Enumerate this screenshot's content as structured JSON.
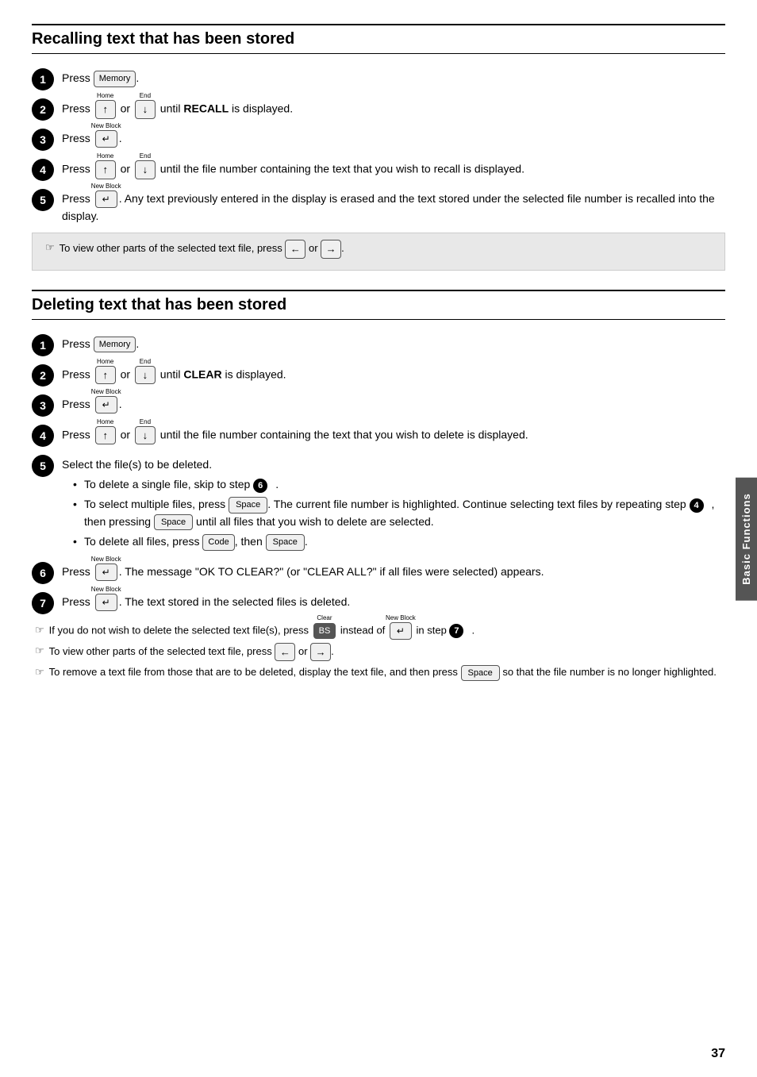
{
  "sections": [
    {
      "id": "recalling",
      "title": "Recalling text that has been stored",
      "steps": [
        {
          "num": 1,
          "text": "Press [Memory]."
        },
        {
          "num": 2,
          "text_before": "Press ",
          "arrow_up_label": "Home",
          "arrow_down_label": "End",
          "text_middle": " or ",
          "text_after": " until ",
          "bold": "RECALL",
          "text_end": " is displayed."
        },
        {
          "num": 3,
          "text": "Press [Enter]."
        },
        {
          "num": 4,
          "text_before": "Press ",
          "text_after": " until the file number containing the text that you wish to recall is displayed."
        },
        {
          "num": 5,
          "text_before": "Press [Enter].",
          "text_after": " Any text previously entered in the display is erased and the text stored under the selected file number is recalled into the display."
        }
      ],
      "tip": "To view other parts of the selected text file, press ← or →."
    }
  ],
  "sections2": [
    {
      "id": "deleting",
      "title": "Deleting text that has been stored",
      "steps": [
        {
          "num": 1,
          "text": "Press [Memory]."
        },
        {
          "num": 2,
          "text_before": "Press ",
          "text_after": " until ",
          "bold": "CLEAR",
          "text_end": " is displayed."
        },
        {
          "num": 3,
          "text": "Press [Enter]."
        },
        {
          "num": 4,
          "text_before": "Press ",
          "text_after": " until the file number containing the text that you wish to delete is displayed."
        },
        {
          "num": 5,
          "text": "Select the file(s) to be deleted.",
          "bullets": [
            "To delete a single file, skip to step 6.",
            "To select multiple files, press [Space]. The current file number is highlighted. Continue selecting text files by repeating step 4, then pressing [Space] until all files that you wish to delete are selected.",
            "To delete all files, press [Code], then [Space]."
          ]
        },
        {
          "num": 6,
          "text_before": "Press [Enter].",
          "text_after": " The message \"OK TO CLEAR?\" (or \"CLEAR ALL?\" if all files were selected) appears."
        },
        {
          "num": 7,
          "text_before": "Press [Enter].",
          "text_after": " The text stored in the selected files is deleted."
        }
      ],
      "tips": [
        "If you do not wish to delete the selected text file(s), press [BS] instead of [Enter] in step 7.",
        "To view other parts of the selected text file, press ← or →.",
        "To remove a text file from those that are to be deleted, display the text file, and then press [Space] so that the file number is no longer highlighted."
      ]
    }
  ],
  "page_number": "37",
  "sidebar_label": "Basic Functions",
  "icons": {
    "tip": "☞"
  }
}
